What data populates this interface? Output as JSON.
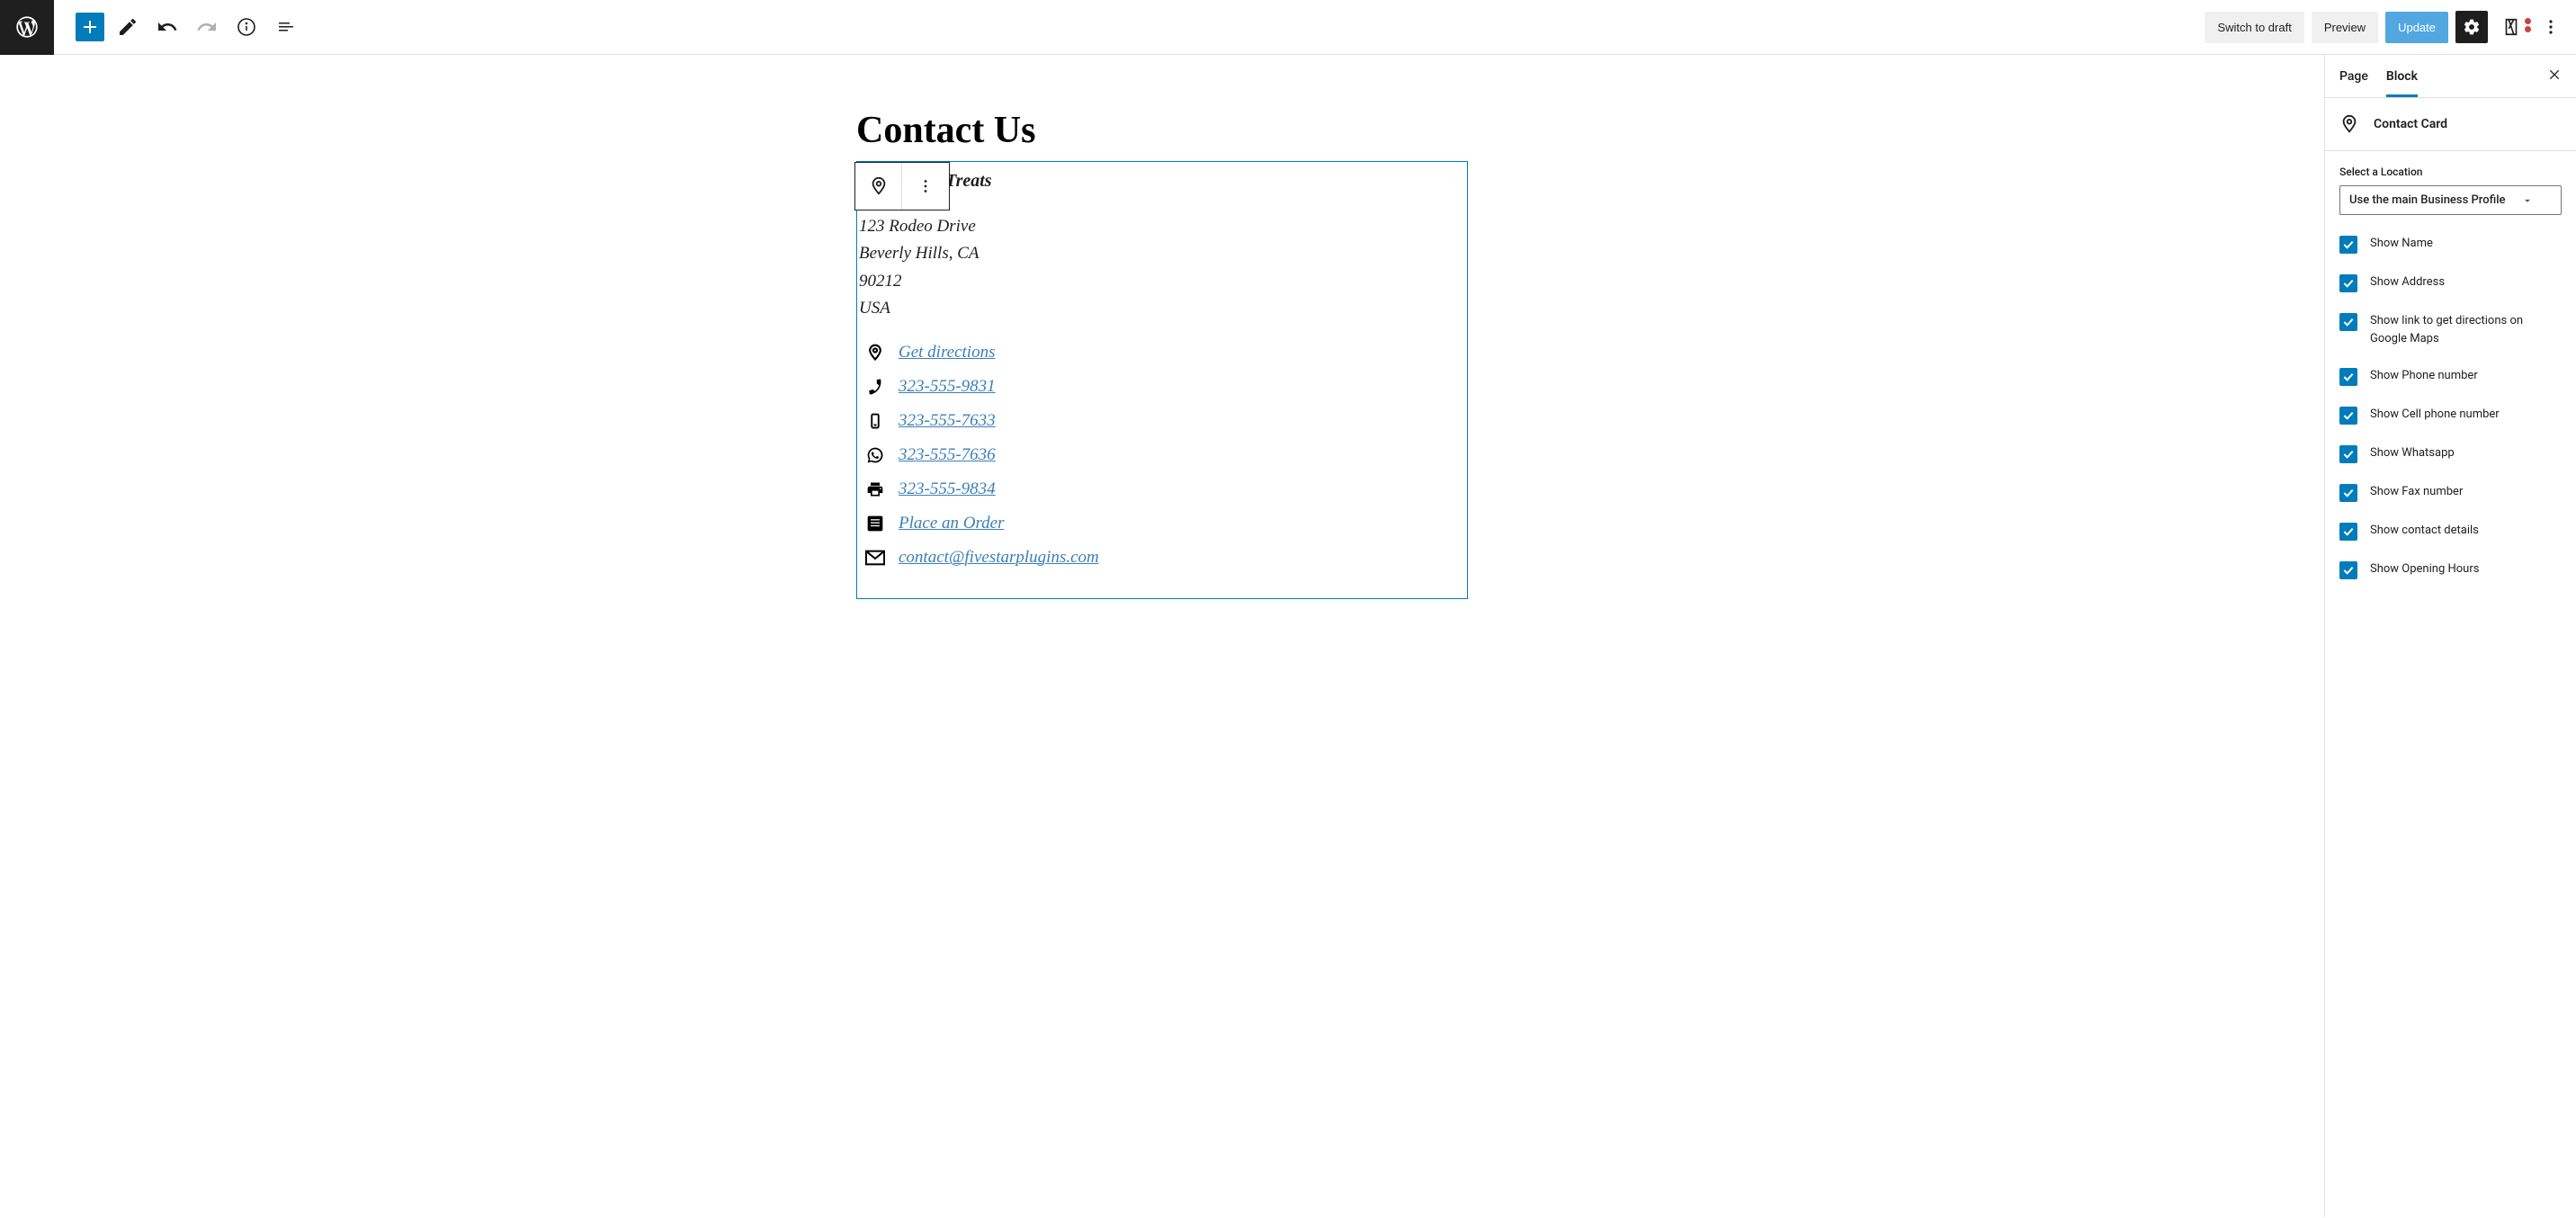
{
  "toolbar": {
    "switch_draft": "Switch to draft",
    "preview": "Preview",
    "update": "Update"
  },
  "page": {
    "title": "Contact Us"
  },
  "contact_card": {
    "name": "Bittersweet Treats",
    "address": {
      "line1": "123 Rodeo Drive",
      "line2": "Beverly Hills, CA",
      "zip": "90212",
      "country": "USA"
    },
    "items": [
      {
        "label": "Get directions",
        "icon": "pin"
      },
      {
        "label": "323-555-9831",
        "icon": "phone"
      },
      {
        "label": "323-555-7633",
        "icon": "mobile"
      },
      {
        "label": "323-555-7636",
        "icon": "whatsapp"
      },
      {
        "label": "323-555-9834",
        "icon": "fax"
      },
      {
        "label": "Place an Order",
        "icon": "form"
      },
      {
        "label": "contact@fivestarplugins.com",
        "icon": "email"
      }
    ]
  },
  "sidebar": {
    "tabs": {
      "page": "Page",
      "block": "Block"
    },
    "block_title": "Contact Card",
    "location_label": "Select a Location",
    "location_value": "Use the main Business Profile",
    "options": [
      "Show Name",
      "Show Address",
      "Show link to get directions on Google Maps",
      "Show Phone number",
      "Show Cell phone number",
      "Show Whatsapp",
      "Show Fax number",
      "Show contact details",
      "Show Opening Hours"
    ]
  }
}
